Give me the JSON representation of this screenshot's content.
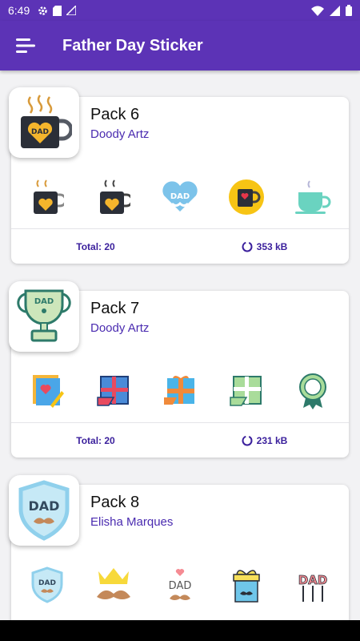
{
  "status_bar": {
    "time": "6:49",
    "icons": [
      "gear-icon",
      "sd-card-icon",
      "signal-icon",
      "wifi-icon",
      "cellular-icon",
      "battery-icon"
    ]
  },
  "app_bar": {
    "title": "Father Day Sticker",
    "menu_icon": "menu-icon"
  },
  "packs": [
    {
      "name": "Pack 6",
      "author": "Doody Artz",
      "total": "Total: 20",
      "size": "353 kB"
    },
    {
      "name": "Pack 7",
      "author": "Doody Artz",
      "total": "Total: 20",
      "size": "231 kB"
    },
    {
      "name": "Pack 8",
      "author": "Elisha Marques",
      "total": "",
      "size": ""
    }
  ],
  "sticker_labels": {
    "dad": "DAD"
  },
  "colors": {
    "primary": "#5c33b6",
    "accent_text": "#3a1f9c",
    "author": "#4a2bb0"
  }
}
